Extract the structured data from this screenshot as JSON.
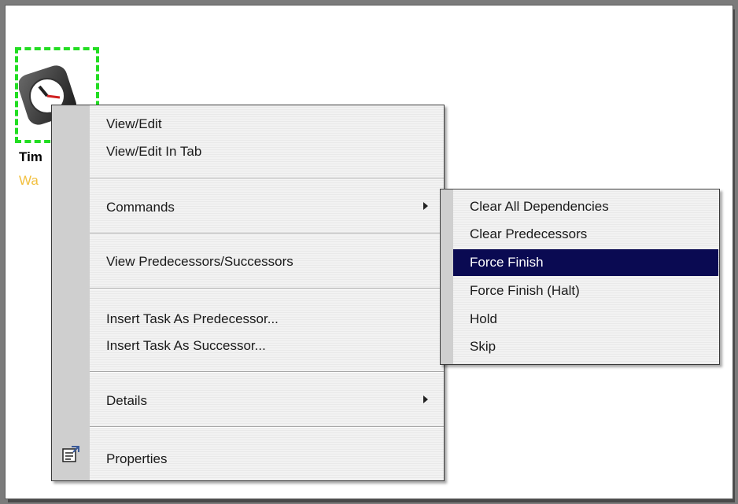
{
  "node": {
    "title": "Tim",
    "status": "Wa"
  },
  "context_menu": {
    "items": [
      {
        "label": "View/Edit"
      },
      {
        "label": "View/Edit In Tab"
      },
      {
        "label": "Commands",
        "has_submenu": true
      },
      {
        "label": "View Predecessors/Successors"
      },
      {
        "label": "Insert Task As Predecessor..."
      },
      {
        "label": "Insert Task As Successor..."
      },
      {
        "label": "Details",
        "has_submenu": true
      },
      {
        "label": "Properties",
        "icon": "properties-icon"
      }
    ]
  },
  "commands_submenu": {
    "items": [
      {
        "label": "Clear All Dependencies"
      },
      {
        "label": "Clear Predecessors"
      },
      {
        "label": "Force Finish",
        "highlighted": true
      },
      {
        "label": "Force Finish (Halt)"
      },
      {
        "label": "Hold"
      },
      {
        "label": "Skip"
      }
    ]
  },
  "colors": {
    "selection": "#0a0a52",
    "node_border": "#22dd22",
    "status_text": "#f2c040"
  }
}
